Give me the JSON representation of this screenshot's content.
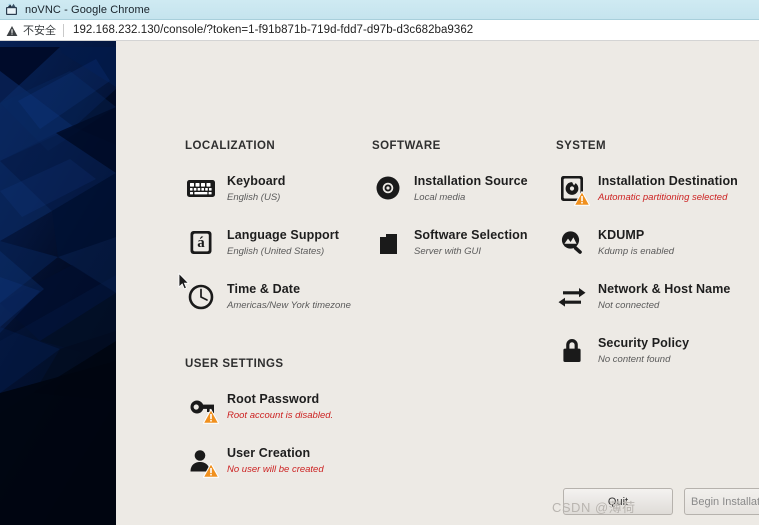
{
  "browser": {
    "window_title": "noVNC - Google Chrome",
    "favicon_name": "novnc-favicon",
    "security_label": "不安全",
    "url": "192.168.232.130/console/?token=1-f91b871b-719d-fdd7-d97b-d3c682ba9362"
  },
  "installer": {
    "sections": {
      "localization": {
        "title": "LOCALIZATION",
        "items": [
          {
            "icon": "keyboard-icon",
            "title": "Keyboard",
            "status": "English (US)",
            "warning": false
          },
          {
            "icon": "language-support-icon",
            "title": "Language Support",
            "status": "English (United States)",
            "warning": false
          },
          {
            "icon": "clock-icon",
            "title": "Time & Date",
            "status": "Americas/New York timezone",
            "warning": false
          }
        ]
      },
      "software": {
        "title": "SOFTWARE",
        "items": [
          {
            "icon": "optical-disc-icon",
            "title": "Installation Source",
            "status": "Local media",
            "warning": false
          },
          {
            "icon": "package-icon",
            "title": "Software Selection",
            "status": "Server with GUI",
            "warning": false
          }
        ]
      },
      "system": {
        "title": "SYSTEM",
        "items": [
          {
            "icon": "hard-drive-icon",
            "title": "Installation Destination",
            "status": "Automatic partitioning selected",
            "warning": true
          },
          {
            "icon": "magnifier-icon",
            "title": "KDUMP",
            "status": "Kdump is enabled",
            "warning": false
          },
          {
            "icon": "network-arrows-icon",
            "title": "Network & Host Name",
            "status": "Not connected",
            "warning": false
          },
          {
            "icon": "padlock-icon",
            "title": "Security Policy",
            "status": "No content found",
            "warning": false
          }
        ]
      },
      "user_settings": {
        "title": "USER SETTINGS",
        "items": [
          {
            "icon": "key-icon",
            "title": "Root Password",
            "status": "Root account is disabled.",
            "warning": true
          },
          {
            "icon": "user-icon",
            "title": "User Creation",
            "status": "No user will be created",
            "warning": true
          }
        ]
      }
    },
    "footer": {
      "quit_label": "Quit",
      "begin_label": "Begin Installation"
    }
  },
  "watermark": {
    "text": "CSDN @薄荷"
  },
  "colors": {
    "page_background": "#edeae5",
    "sidebar_dark_blue": "#000a22",
    "sidebar_accent_blue": "#10346e",
    "warning_red": "#cc2222",
    "warning_orange": "#f0901e",
    "title_bar_cyan": "#c5e4ee"
  }
}
